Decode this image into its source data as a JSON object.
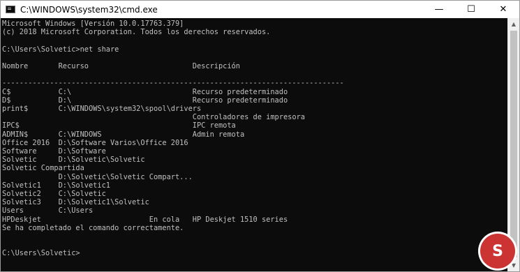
{
  "window": {
    "title": "C:\\WINDOWS\\system32\\cmd.exe",
    "minimize_glyph": "—",
    "maximize_glyph": "☐",
    "close_glyph": "✕"
  },
  "console": {
    "lines": [
      "Microsoft Windows [Versión 10.0.17763.379]",
      "(c) 2018 Microsoft Corporation. Todos los derechos reservados.",
      "",
      "C:\\Users\\Solvetic>net share",
      "",
      "Nombre       Recurso                        Descripción",
      "",
      "-------------------------------------------------------------------------------",
      "C$           C:\\                            Recurso predeterminado",
      "D$           D:\\                            Recurso predeterminado",
      "print$       C:\\WINDOWS\\system32\\spool\\drivers",
      "                                            Controladores de impresora",
      "IPC$                                        IPC remota",
      "ADMIN$       C:\\WINDOWS                     Admin remota",
      "Office 2016  D:\\Software Varios\\Office 2016",
      "Software     D:\\Software",
      "Solvetic     D:\\Solvetic\\Solvetic",
      "Solvetic Compartida",
      "             D:\\Solvetic\\Solvetic Compart...",
      "Solvetic1    D:\\Solvetic1",
      "Solvetic2    C:\\Solvetic",
      "Solvetic3    D:\\Solvetic1\\Solvetic",
      "Users        C:\\Users",
      "HPDeskjet                         En cola   HP Deskjet 1510 series",
      "Se ha completado el comando correctamente.",
      "",
      "",
      "C:\\Users\\Solvetic>"
    ]
  },
  "scrollbar": {
    "up_glyph": "▲",
    "down_glyph": "▼"
  },
  "watermark": {
    "glyph": "S",
    "color": "#cc3333"
  }
}
